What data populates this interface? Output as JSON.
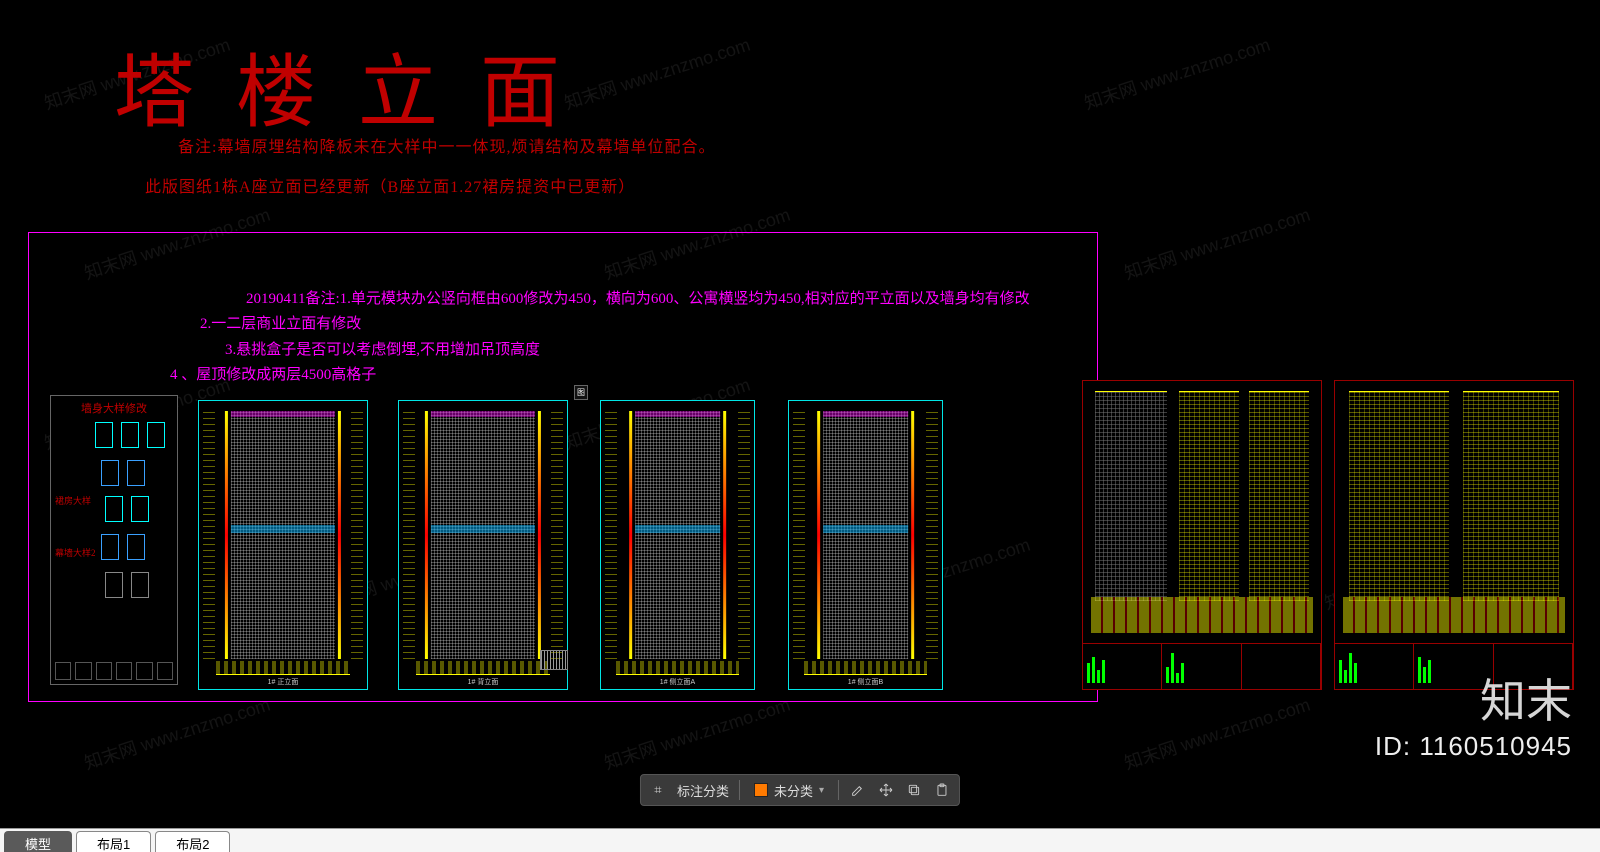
{
  "title": "塔楼立面",
  "notes": {
    "n1": "备注:幕墙原埋结构降板未在大样中一一体现,烦请结构及幕墙单位配合。",
    "n2": "此版图纸1栋A座立面已经更新（B座立面1.27裙房提资中已更新）"
  },
  "revision_notes": {
    "l1": "20190411备注:1.单元模块办公竖向框由600修改为450，横向为600、公寓横竖均为450,相对应的平立面以及墙身均有修改",
    "l2": "2.一二层商业立面有修改",
    "l3": "3.悬挑盒子是否可以考虑倒埋,不用增加吊顶高度",
    "l4": "4 、屋顶修改成两层4500高格子"
  },
  "detail_card": {
    "header": "墙身大样修改",
    "side1": "裙房大样",
    "side2": "幕墙大样2"
  },
  "elevations": [
    {
      "caption": "1# 正立面"
    },
    {
      "caption": "1# 背立面"
    },
    {
      "caption": "1# 侧立面A"
    },
    {
      "caption": "1# 侧立面B"
    }
  ],
  "toolbar": {
    "icon_left": "⌗",
    "label_classify": "标注分类",
    "status_unclassified": "未分类"
  },
  "tabs": {
    "model": "模型",
    "layout1": "布局1",
    "layout2": "布局2"
  },
  "watermark": {
    "brand": "知末",
    "idline": "ID: 1160510945",
    "wm_text": "知末网 www.znzmo.com"
  },
  "marker": "图"
}
